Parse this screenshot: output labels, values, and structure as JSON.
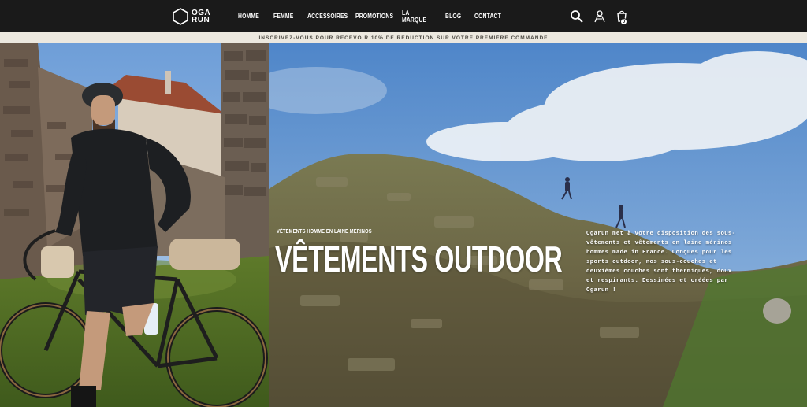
{
  "header": {
    "logo_text": "OGA\nRUN",
    "nav": [
      "HOMME",
      "FEMME",
      "ACCESSOIRES",
      "PROMOTIONS",
      "LA MARQUE",
      "BLOG",
      "CONTACT"
    ],
    "icons": [
      "search-icon",
      "account-icon",
      "cart-icon"
    ],
    "cart_count": "0"
  },
  "promo": {
    "text": "INSCRIVEZ-VOUS POUR RECEVOIR 10% DE RÉDUCTION SUR VOTRE PREMIÈRE COMMANDE"
  },
  "hero": {
    "caption": "VÊTEMENTS HOMME EN LAINE MÉRINOS",
    "title": "VÊTEMENTS OUTDOOR",
    "description": "Ogarun met à votre disposition des sous-vêtements et vêtements en laine mérinos hommes made in France. Conçues pour les sports outdoor, nos sous-couches et deuxièmes couches sont thermiques, doux et respirants. Dessinées et créées par Ogarun !"
  },
  "colors": {
    "header_bg": "#1a1a1a",
    "promo_bg": "#ece8df",
    "promo_text": "#4a4740",
    "text_on_dark": "#ffffff"
  }
}
